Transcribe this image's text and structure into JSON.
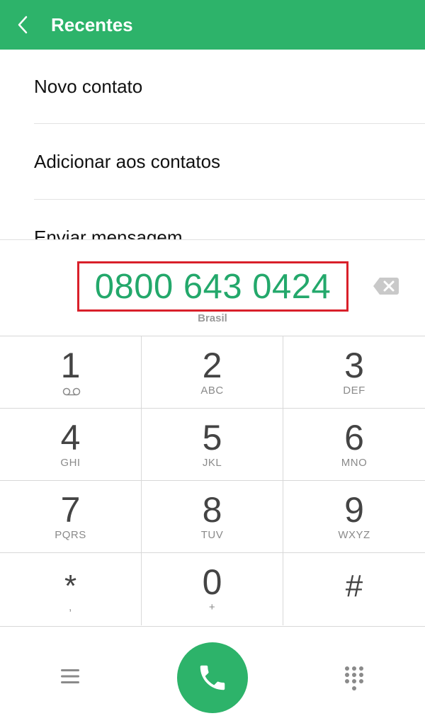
{
  "header": {
    "title": "Recentes",
    "back_icon": "chevron-left-icon",
    "background": "#2db36a"
  },
  "menu": {
    "items": [
      {
        "label": "Novo contato"
      },
      {
        "label": "Adicionar aos contatos"
      },
      {
        "label": "Enviar mensagem"
      }
    ]
  },
  "dialer": {
    "number": "0800 643 0424",
    "country": "Brasil",
    "number_color": "#23a86b",
    "highlight_color": "#d9202a",
    "backspace_icon": "backspace-icon"
  },
  "keypad": {
    "keys": [
      {
        "digit": "1",
        "sub": "",
        "sub_icon": "voicemail-icon"
      },
      {
        "digit": "2",
        "sub": "ABC"
      },
      {
        "digit": "3",
        "sub": "DEF"
      },
      {
        "digit": "4",
        "sub": "GHI"
      },
      {
        "digit": "5",
        "sub": "JKL"
      },
      {
        "digit": "6",
        "sub": "MNO"
      },
      {
        "digit": "7",
        "sub": "PQRS"
      },
      {
        "digit": "8",
        "sub": "TUV"
      },
      {
        "digit": "9",
        "sub": "WXYZ"
      },
      {
        "digit": "*",
        "sub": ","
      },
      {
        "digit": "0",
        "sub": "+"
      },
      {
        "digit": "#",
        "sub": ""
      }
    ]
  },
  "bottom_bar": {
    "menu_icon": "hamburger-menu-icon",
    "call_icon": "phone-icon",
    "dialpad_icon": "dialpad-icon",
    "call_color": "#2db36a"
  }
}
